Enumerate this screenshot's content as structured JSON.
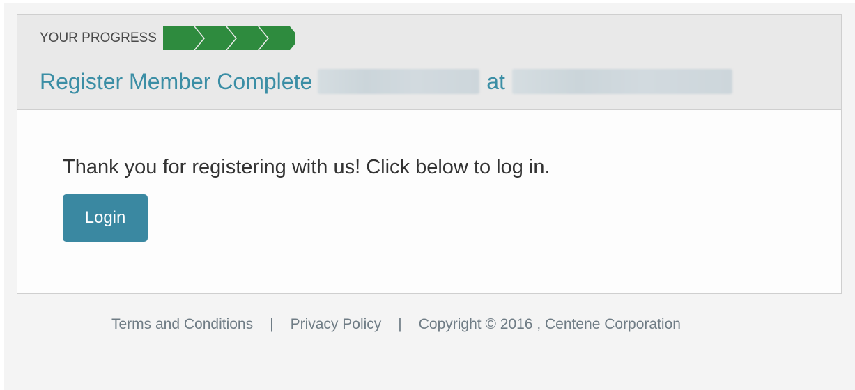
{
  "header": {
    "progress_label": "YOUR PROGRESS",
    "progress_steps_total": 4,
    "progress_color": "#2e8b3e",
    "title": "Register Member Complete",
    "at_label": "at"
  },
  "body": {
    "message": "Thank you for registering with us! Click below to log in.",
    "login_label": "Login",
    "accent_color": "#3a88a1"
  },
  "footer": {
    "terms_label": "Terms and Conditions",
    "separator": "|",
    "privacy_label": "Privacy Policy",
    "copyright": "Copyright © 2016 , Centene Corporation"
  }
}
